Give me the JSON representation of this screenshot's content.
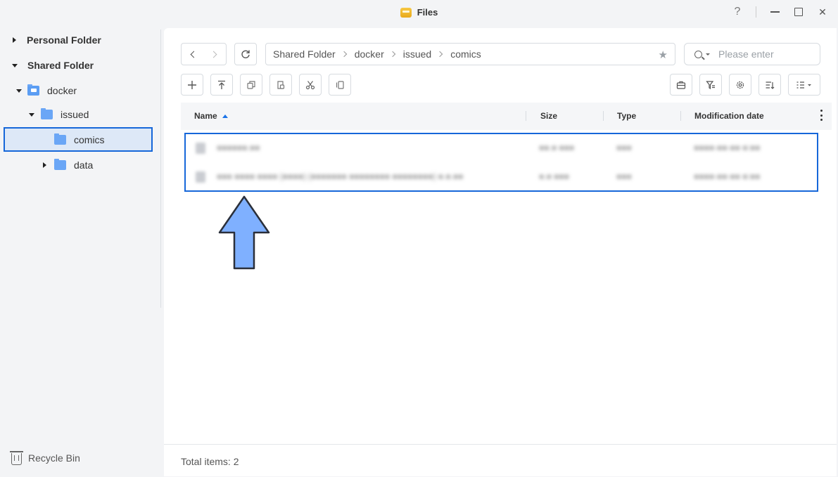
{
  "window": {
    "title": "Files",
    "help_glyph": "?",
    "close_glyph": "✕"
  },
  "sidebar": {
    "personal_folder": "Personal Folder",
    "shared_folder": "Shared Folder",
    "tree": [
      {
        "label": "docker",
        "expanded": true
      },
      {
        "label": "issued",
        "expanded": true
      },
      {
        "label": "comics",
        "selected": true
      },
      {
        "label": "data",
        "expanded": false
      }
    ],
    "recycle_bin": "Recycle Bin"
  },
  "breadcrumb": [
    "Shared Folder",
    "docker",
    "issued",
    "comics"
  ],
  "search": {
    "placeholder": "Please enter",
    "value": ""
  },
  "table": {
    "columns": [
      "Name",
      "Size",
      "Type",
      "Modification date"
    ],
    "sort": {
      "column": "Name",
      "direction": "ascending"
    },
    "rows": [
      {
        "name": "●●●●●●.●●",
        "size": "●●.● ●●●",
        "type": "●●●",
        "date": "●●●●-●●-●● ●:●●"
      },
      {
        "name": "●●● ●●●● ●●●● (●●●●) (●●●●●●● ●●●●●●●● ●●●●●●●●) ●.●.●●",
        "size": "●.● ●●●",
        "type": "●●●",
        "date": "●●●●-●●-●● ●:●●"
      }
    ]
  },
  "footer": {
    "total_items": "Total items: 2"
  },
  "colors": {
    "accent": "#1a73e8",
    "highlight_border": "#1667d9",
    "arrow_fill": "#7fb0ff",
    "folder": "#6aa6f6"
  },
  "icons": [
    "files-app-icon",
    "help-icon",
    "minimize-icon",
    "maximize-icon",
    "close-icon",
    "back-icon",
    "forward-icon",
    "refresh-icon",
    "star-icon",
    "search-icon",
    "create-icon",
    "upload-icon",
    "copy-icon",
    "paste-icon",
    "cut-icon",
    "duplicate-icon",
    "toolbox-icon",
    "filter-icon",
    "settings-icon",
    "sort-icon",
    "view-mode-icon",
    "recycle-bin-icon"
  ]
}
